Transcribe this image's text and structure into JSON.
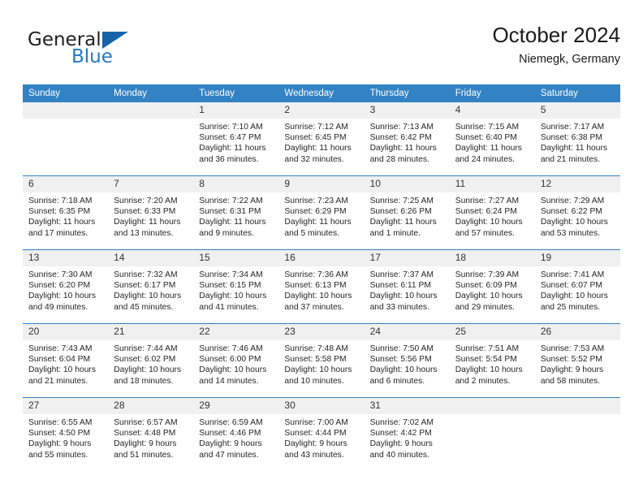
{
  "brand": {
    "name_part1": "General",
    "name_part2": "Blue",
    "flag_icon": "blue-triangle-flag-icon"
  },
  "header": {
    "title": "October 2024",
    "subtitle": "Niemegk, Germany"
  },
  "colors": {
    "header_row_bg": "#3282c4",
    "daynum_bg": "#f0f0f0",
    "brand_blue": "#1f7ac4",
    "text": "#262626"
  },
  "weekday_headers": [
    "Sunday",
    "Monday",
    "Tuesday",
    "Wednesday",
    "Thursday",
    "Friday",
    "Saturday"
  ],
  "labels": {
    "sunrise_prefix": "Sunrise:",
    "sunset_prefix": "Sunset:",
    "daylight_prefix": "Daylight:"
  },
  "weeks": [
    [
      {
        "day": "",
        "blank": true,
        "line1": "",
        "line2": "",
        "line3": "",
        "line4": ""
      },
      {
        "day": "",
        "blank": true,
        "line1": "",
        "line2": "",
        "line3": "",
        "line4": ""
      },
      {
        "day": "1",
        "line1": "Sunrise: 7:10 AM",
        "line2": "Sunset: 6:47 PM",
        "line3": "Daylight: 11 hours",
        "line4": "and 36 minutes."
      },
      {
        "day": "2",
        "line1": "Sunrise: 7:12 AM",
        "line2": "Sunset: 6:45 PM",
        "line3": "Daylight: 11 hours",
        "line4": "and 32 minutes."
      },
      {
        "day": "3",
        "line1": "Sunrise: 7:13 AM",
        "line2": "Sunset: 6:42 PM",
        "line3": "Daylight: 11 hours",
        "line4": "and 28 minutes."
      },
      {
        "day": "4",
        "line1": "Sunrise: 7:15 AM",
        "line2": "Sunset: 6:40 PM",
        "line3": "Daylight: 11 hours",
        "line4": "and 24 minutes."
      },
      {
        "day": "5",
        "line1": "Sunrise: 7:17 AM",
        "line2": "Sunset: 6:38 PM",
        "line3": "Daylight: 11 hours",
        "line4": "and 21 minutes."
      }
    ],
    [
      {
        "day": "6",
        "line1": "Sunrise: 7:18 AM",
        "line2": "Sunset: 6:35 PM",
        "line3": "Daylight: 11 hours",
        "line4": "and 17 minutes."
      },
      {
        "day": "7",
        "line1": "Sunrise: 7:20 AM",
        "line2": "Sunset: 6:33 PM",
        "line3": "Daylight: 11 hours",
        "line4": "and 13 minutes."
      },
      {
        "day": "8",
        "line1": "Sunrise: 7:22 AM",
        "line2": "Sunset: 6:31 PM",
        "line3": "Daylight: 11 hours",
        "line4": "and 9 minutes."
      },
      {
        "day": "9",
        "line1": "Sunrise: 7:23 AM",
        "line2": "Sunset: 6:29 PM",
        "line3": "Daylight: 11 hours",
        "line4": "and 5 minutes."
      },
      {
        "day": "10",
        "line1": "Sunrise: 7:25 AM",
        "line2": "Sunset: 6:26 PM",
        "line3": "Daylight: 11 hours",
        "line4": "and 1 minute."
      },
      {
        "day": "11",
        "line1": "Sunrise: 7:27 AM",
        "line2": "Sunset: 6:24 PM",
        "line3": "Daylight: 10 hours",
        "line4": "and 57 minutes."
      },
      {
        "day": "12",
        "line1": "Sunrise: 7:29 AM",
        "line2": "Sunset: 6:22 PM",
        "line3": "Daylight: 10 hours",
        "line4": "and 53 minutes."
      }
    ],
    [
      {
        "day": "13",
        "line1": "Sunrise: 7:30 AM",
        "line2": "Sunset: 6:20 PM",
        "line3": "Daylight: 10 hours",
        "line4": "and 49 minutes."
      },
      {
        "day": "14",
        "line1": "Sunrise: 7:32 AM",
        "line2": "Sunset: 6:17 PM",
        "line3": "Daylight: 10 hours",
        "line4": "and 45 minutes."
      },
      {
        "day": "15",
        "line1": "Sunrise: 7:34 AM",
        "line2": "Sunset: 6:15 PM",
        "line3": "Daylight: 10 hours",
        "line4": "and 41 minutes."
      },
      {
        "day": "16",
        "line1": "Sunrise: 7:36 AM",
        "line2": "Sunset: 6:13 PM",
        "line3": "Daylight: 10 hours",
        "line4": "and 37 minutes."
      },
      {
        "day": "17",
        "line1": "Sunrise: 7:37 AM",
        "line2": "Sunset: 6:11 PM",
        "line3": "Daylight: 10 hours",
        "line4": "and 33 minutes."
      },
      {
        "day": "18",
        "line1": "Sunrise: 7:39 AM",
        "line2": "Sunset: 6:09 PM",
        "line3": "Daylight: 10 hours",
        "line4": "and 29 minutes."
      },
      {
        "day": "19",
        "line1": "Sunrise: 7:41 AM",
        "line2": "Sunset: 6:07 PM",
        "line3": "Daylight: 10 hours",
        "line4": "and 25 minutes."
      }
    ],
    [
      {
        "day": "20",
        "line1": "Sunrise: 7:43 AM",
        "line2": "Sunset: 6:04 PM",
        "line3": "Daylight: 10 hours",
        "line4": "and 21 minutes."
      },
      {
        "day": "21",
        "line1": "Sunrise: 7:44 AM",
        "line2": "Sunset: 6:02 PM",
        "line3": "Daylight: 10 hours",
        "line4": "and 18 minutes."
      },
      {
        "day": "22",
        "line1": "Sunrise: 7:46 AM",
        "line2": "Sunset: 6:00 PM",
        "line3": "Daylight: 10 hours",
        "line4": "and 14 minutes."
      },
      {
        "day": "23",
        "line1": "Sunrise: 7:48 AM",
        "line2": "Sunset: 5:58 PM",
        "line3": "Daylight: 10 hours",
        "line4": "and 10 minutes."
      },
      {
        "day": "24",
        "line1": "Sunrise: 7:50 AM",
        "line2": "Sunset: 5:56 PM",
        "line3": "Daylight: 10 hours",
        "line4": "and 6 minutes."
      },
      {
        "day": "25",
        "line1": "Sunrise: 7:51 AM",
        "line2": "Sunset: 5:54 PM",
        "line3": "Daylight: 10 hours",
        "line4": "and 2 minutes."
      },
      {
        "day": "26",
        "line1": "Sunrise: 7:53 AM",
        "line2": "Sunset: 5:52 PM",
        "line3": "Daylight: 9 hours",
        "line4": "and 58 minutes."
      }
    ],
    [
      {
        "day": "27",
        "line1": "Sunrise: 6:55 AM",
        "line2": "Sunset: 4:50 PM",
        "line3": "Daylight: 9 hours",
        "line4": "and 55 minutes."
      },
      {
        "day": "28",
        "line1": "Sunrise: 6:57 AM",
        "line2": "Sunset: 4:48 PM",
        "line3": "Daylight: 9 hours",
        "line4": "and 51 minutes."
      },
      {
        "day": "29",
        "line1": "Sunrise: 6:59 AM",
        "line2": "Sunset: 4:46 PM",
        "line3": "Daylight: 9 hours",
        "line4": "and 47 minutes."
      },
      {
        "day": "30",
        "line1": "Sunrise: 7:00 AM",
        "line2": "Sunset: 4:44 PM",
        "line3": "Daylight: 9 hours",
        "line4": "and 43 minutes."
      },
      {
        "day": "31",
        "line1": "Sunrise: 7:02 AM",
        "line2": "Sunset: 4:42 PM",
        "line3": "Daylight: 9 hours",
        "line4": "and 40 minutes."
      },
      {
        "day": "",
        "blank": true,
        "line1": "",
        "line2": "",
        "line3": "",
        "line4": ""
      },
      {
        "day": "",
        "blank": true,
        "line1": "",
        "line2": "",
        "line3": "",
        "line4": ""
      }
    ]
  ]
}
